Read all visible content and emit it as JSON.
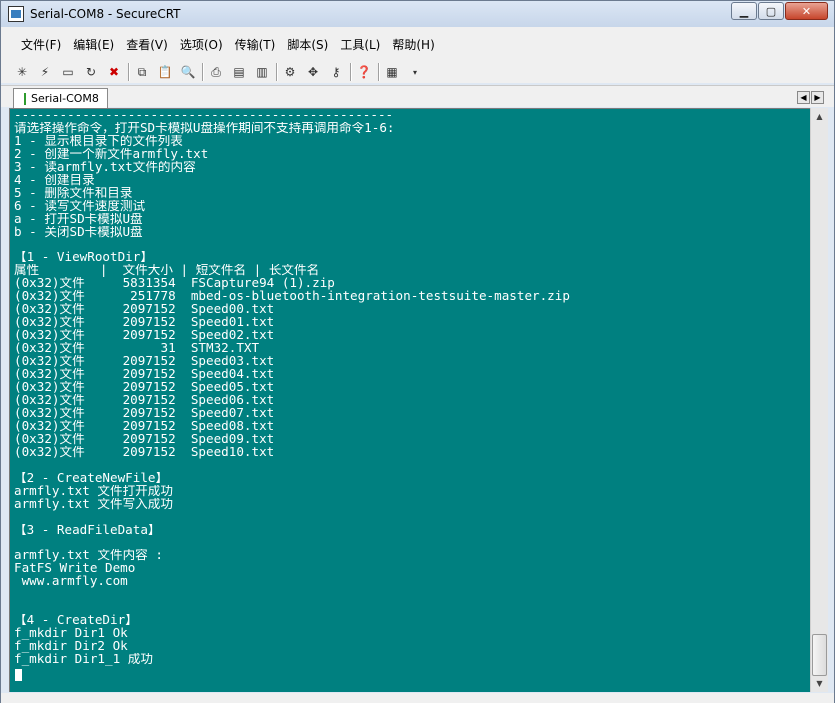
{
  "window": {
    "title": "Serial-COM8 - SecureCRT"
  },
  "menu": [
    "文件(F)",
    "编辑(E)",
    "查看(V)",
    "选项(O)",
    "传输(T)",
    "脚本(S)",
    "工具(L)",
    "帮助(H)"
  ],
  "toolbar": {
    "icons": [
      "connect-icon",
      "quick-connect-icon",
      "connect-tab-icon",
      "reconnect-icon",
      "disconnect-icon",
      "copy-icon",
      "paste-icon",
      "find-icon",
      "print-icon",
      "print-selection-icon",
      "printer-setup-icon",
      "session-options-icon",
      "global-options-icon",
      "key-icon",
      "help-icon",
      "keymap-icon"
    ]
  },
  "tab": {
    "label": "Serial-COM8"
  },
  "terminal": {
    "lines": [
      "--------------------------------------------------",
      "请选择操作命令，打开SD卡模拟U盘操作期间不支持再调用命令1-6:",
      "1 - 显示根目录下的文件列表",
      "2 - 创建一个新文件armfly.txt",
      "3 - 读armfly.txt文件的内容",
      "4 - 创建目录",
      "5 - 删除文件和目录",
      "6 - 读写文件速度测试",
      "a - 打开SD卡模拟U盘",
      "b - 关闭SD卡模拟U盘",
      "",
      "【1 - ViewRootDir】",
      "属性        |  文件大小 | 短文件名 | 长文件名",
      "(0x32)文件     5831354  FSCapture94 (1).zip",
      "(0x32)文件      251778  mbed-os-bluetooth-integration-testsuite-master.zip",
      "(0x32)文件     2097152  Speed00.txt",
      "(0x32)文件     2097152  Speed01.txt",
      "(0x32)文件     2097152  Speed02.txt",
      "(0x32)文件          31  STM32.TXT",
      "(0x32)文件     2097152  Speed03.txt",
      "(0x32)文件     2097152  Speed04.txt",
      "(0x32)文件     2097152  Speed05.txt",
      "(0x32)文件     2097152  Speed06.txt",
      "(0x32)文件     2097152  Speed07.txt",
      "(0x32)文件     2097152  Speed08.txt",
      "(0x32)文件     2097152  Speed09.txt",
      "(0x32)文件     2097152  Speed10.txt",
      "",
      "【2 - CreateNewFile】",
      "armfly.txt 文件打开成功",
      "armfly.txt 文件写入成功",
      "",
      "【3 - ReadFileData】",
      "",
      "armfly.txt 文件内容 :",
      "FatFS Write Demo",
      " www.armfly.com",
      "",
      "",
      "【4 - CreateDir】",
      "f_mkdir Dir1 Ok",
      "f_mkdir Dir2 Ok",
      "f_mkdir Dir1_1 成功"
    ]
  },
  "colors": {
    "terminal_bg": "#008080",
    "terminal_fg": "#ffffff"
  }
}
